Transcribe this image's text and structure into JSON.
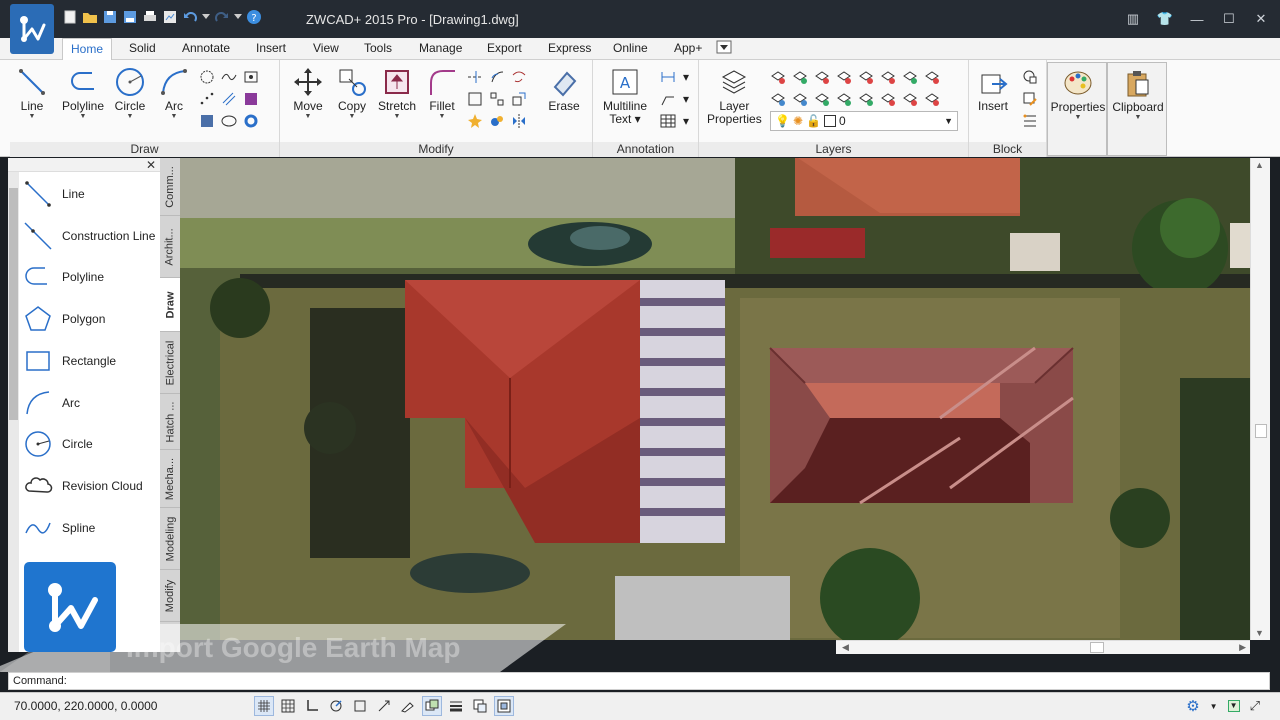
{
  "window": {
    "title": "ZWCAD+ 2015 Pro - [Drawing1.dwg]"
  },
  "menu_tabs": [
    "Home",
    "Solid",
    "Annotate",
    "Insert",
    "View",
    "Tools",
    "Manage",
    "Export",
    "Express",
    "Online",
    "App+"
  ],
  "ribbon": {
    "draw": {
      "title": "Draw",
      "line": "Line",
      "polyline": "Polyline",
      "circle": "Circle",
      "arc": "Arc"
    },
    "modify": {
      "title": "Modify",
      "move": "Move",
      "copy": "Copy",
      "stretch": "Stretch",
      "fillet": "Fillet",
      "erase": "Erase"
    },
    "annotation": {
      "title": "Annotation",
      "multiline_text": "Multiline",
      "multiline_text2": "Text"
    },
    "layers": {
      "title": "Layers",
      "layer_properties": "Layer",
      "layer_properties2": "Properties",
      "current_layer": "0"
    },
    "block": {
      "title": "Block",
      "insert": "Insert"
    },
    "properties": "Properties",
    "clipboard": "Clipboard"
  },
  "palette": {
    "tools": [
      "Line",
      "Construction Line",
      "Polyline",
      "Polygon",
      "Rectangle",
      "Arc",
      "Circle",
      "Revision Cloud",
      "Spline"
    ],
    "tabs": [
      "Comm...",
      "Archit...",
      "Draw",
      "Electrical",
      "Hatch ...",
      "Mecha...",
      "Modeling",
      "Modify"
    ]
  },
  "overlay": {
    "banner_text": "Import Google Earth Map"
  },
  "command": {
    "label": "Command:",
    "value": ""
  },
  "status": {
    "coordinates": "70.0000,  220.0000, 0.0000"
  },
  "colors": {
    "accent": "#2a6fc9",
    "title_bg": "#252b33",
    "roof_red": "#a8382c",
    "drawn_roof": "#8a4a48"
  }
}
